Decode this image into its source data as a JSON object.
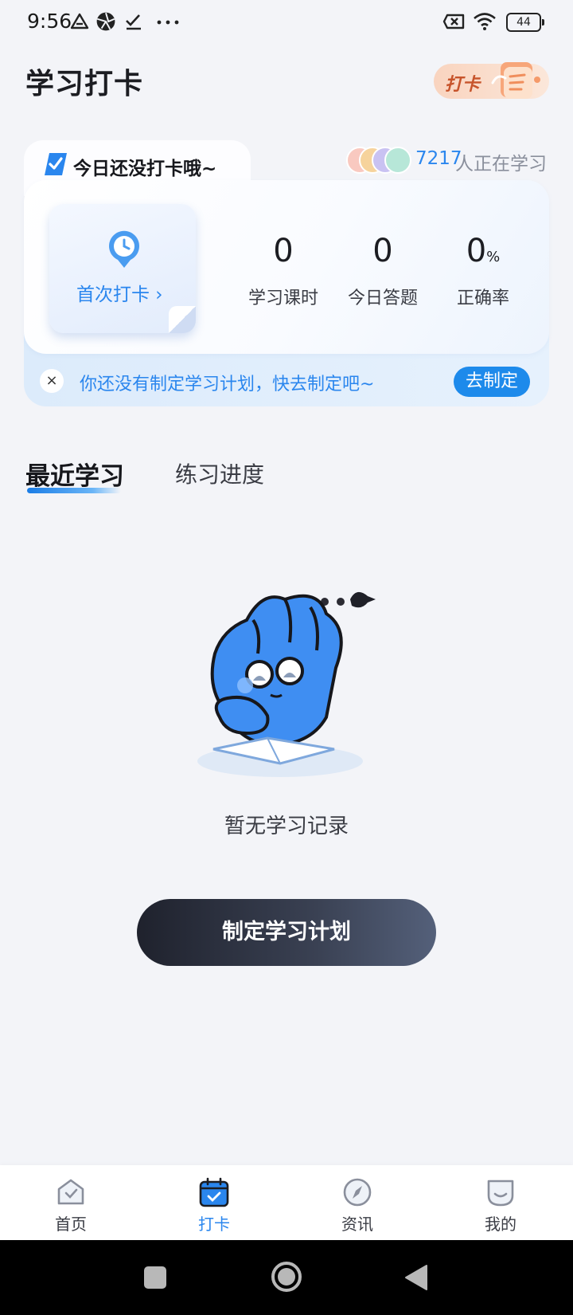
{
  "status_bar": {
    "time": "9:56",
    "battery": "44",
    "icons": [
      "triangle-notify-icon",
      "aperture-icon",
      "check-icon",
      "more-dots-icon",
      "sim-x-icon",
      "wifi-icon",
      "battery-icon"
    ]
  },
  "header": {
    "title": "学习打卡",
    "badge_label": "打卡"
  },
  "checkin_card": {
    "tab_text": "今日还没打卡哦~",
    "learners_count": "7217",
    "learners_suffix": "人正在学习",
    "first_checkin_label": "首次打卡 ›",
    "stats": [
      {
        "value": "0",
        "unit": "",
        "label": "学习课时"
      },
      {
        "value": "0",
        "unit": "",
        "label": "今日答题"
      },
      {
        "value": "0",
        "unit": "%",
        "label": "正确率"
      }
    ],
    "plan_notice": "你还没有制定学习计划，快去制定吧~",
    "plan_button": "去制定",
    "close_symbol": "×"
  },
  "tabs": [
    {
      "label": "最近学习",
      "active": true
    },
    {
      "label": "练习进度",
      "active": false
    }
  ],
  "empty_state": {
    "text": "暂无学习记录",
    "button": "制定学习计划"
  },
  "bottom_nav": [
    {
      "label": "首页",
      "icon": "home-icon",
      "active": false
    },
    {
      "label": "打卡",
      "icon": "calendar-check-icon",
      "active": true
    },
    {
      "label": "资讯",
      "icon": "compass-icon",
      "active": false
    },
    {
      "label": "我的",
      "icon": "profile-icon",
      "active": false
    }
  ],
  "colors": {
    "accent": "#2a86ee",
    "background": "#f3f4f8",
    "button_dark": "#1f222d"
  }
}
